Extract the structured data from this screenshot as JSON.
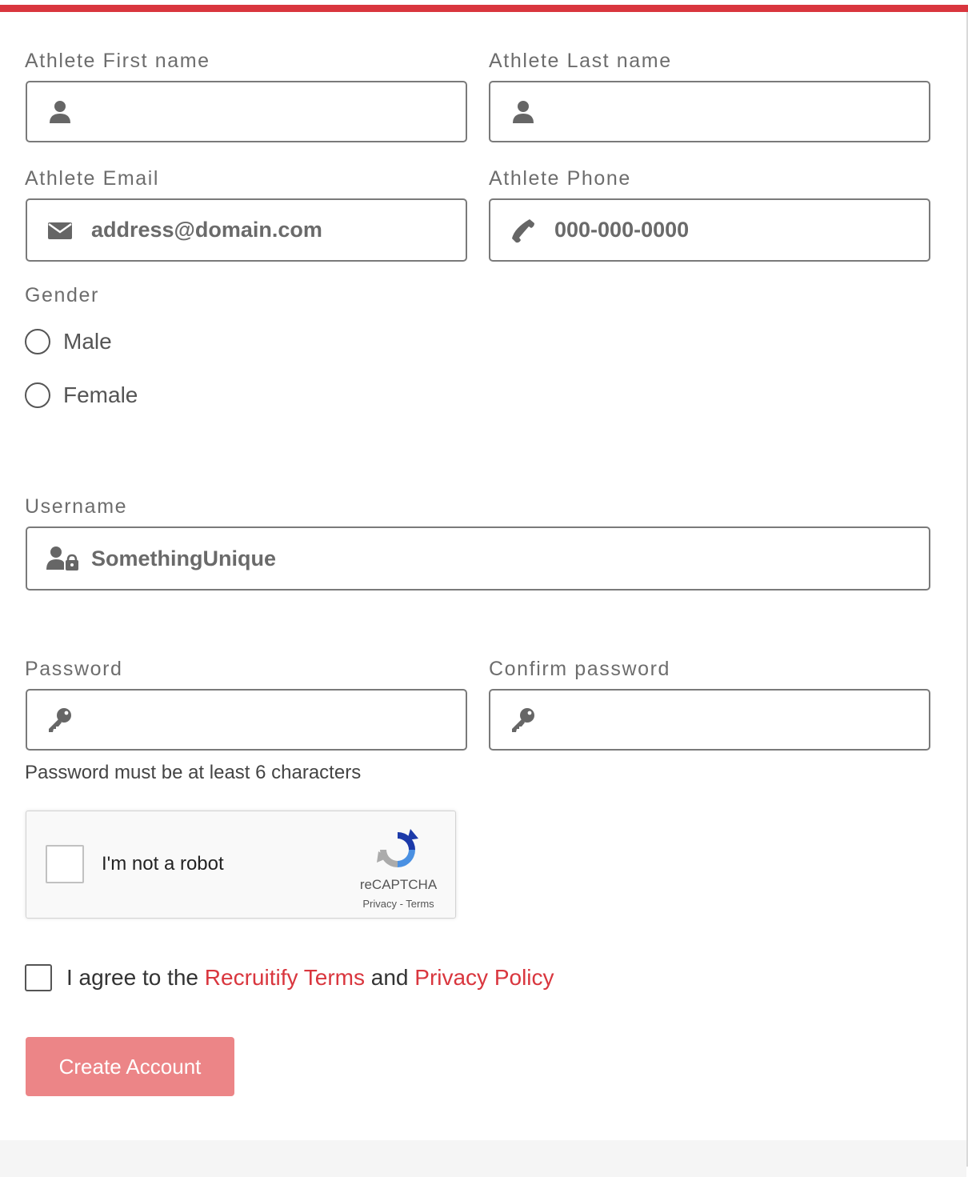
{
  "form": {
    "first_name": {
      "label": "Athlete First name",
      "value": "",
      "placeholder": "",
      "icon": "user-icon"
    },
    "last_name": {
      "label": "Athlete Last name",
      "value": "",
      "placeholder": "",
      "icon": "user-icon"
    },
    "email": {
      "label": "Athlete Email",
      "value": "",
      "placeholder": "address@domain.com",
      "icon": "envelope-icon"
    },
    "phone": {
      "label": "Athlete Phone",
      "value": "",
      "placeholder": "000-000-0000",
      "icon": "phone-icon"
    },
    "gender": {
      "label": "Gender",
      "options": [
        "Male",
        "Female"
      ],
      "selected": null
    },
    "username": {
      "label": "Username",
      "value": "",
      "placeholder": "SomethingUnique",
      "icon": "user-lock-icon"
    },
    "password": {
      "label": "Password",
      "value": "",
      "icon": "key-icon"
    },
    "confirm_password": {
      "label": "Confirm password",
      "value": "",
      "icon": "key-icon"
    },
    "password_hint": "Password must be at least 6 characters"
  },
  "captcha": {
    "text": "I'm not a robot",
    "brand": "reCAPTCHA",
    "privacy": "Privacy",
    "separator": " - ",
    "terms": "Terms"
  },
  "agreement": {
    "prefix": "I agree to the ",
    "terms_link": "Recruitify Terms",
    "middle": " and ",
    "privacy_link": "Privacy Policy"
  },
  "submit_label": "Create Account",
  "colors": {
    "accent": "#d9363e",
    "button": "#ec8587",
    "border": "#7a7a7a",
    "label": "#6d6d6d"
  }
}
